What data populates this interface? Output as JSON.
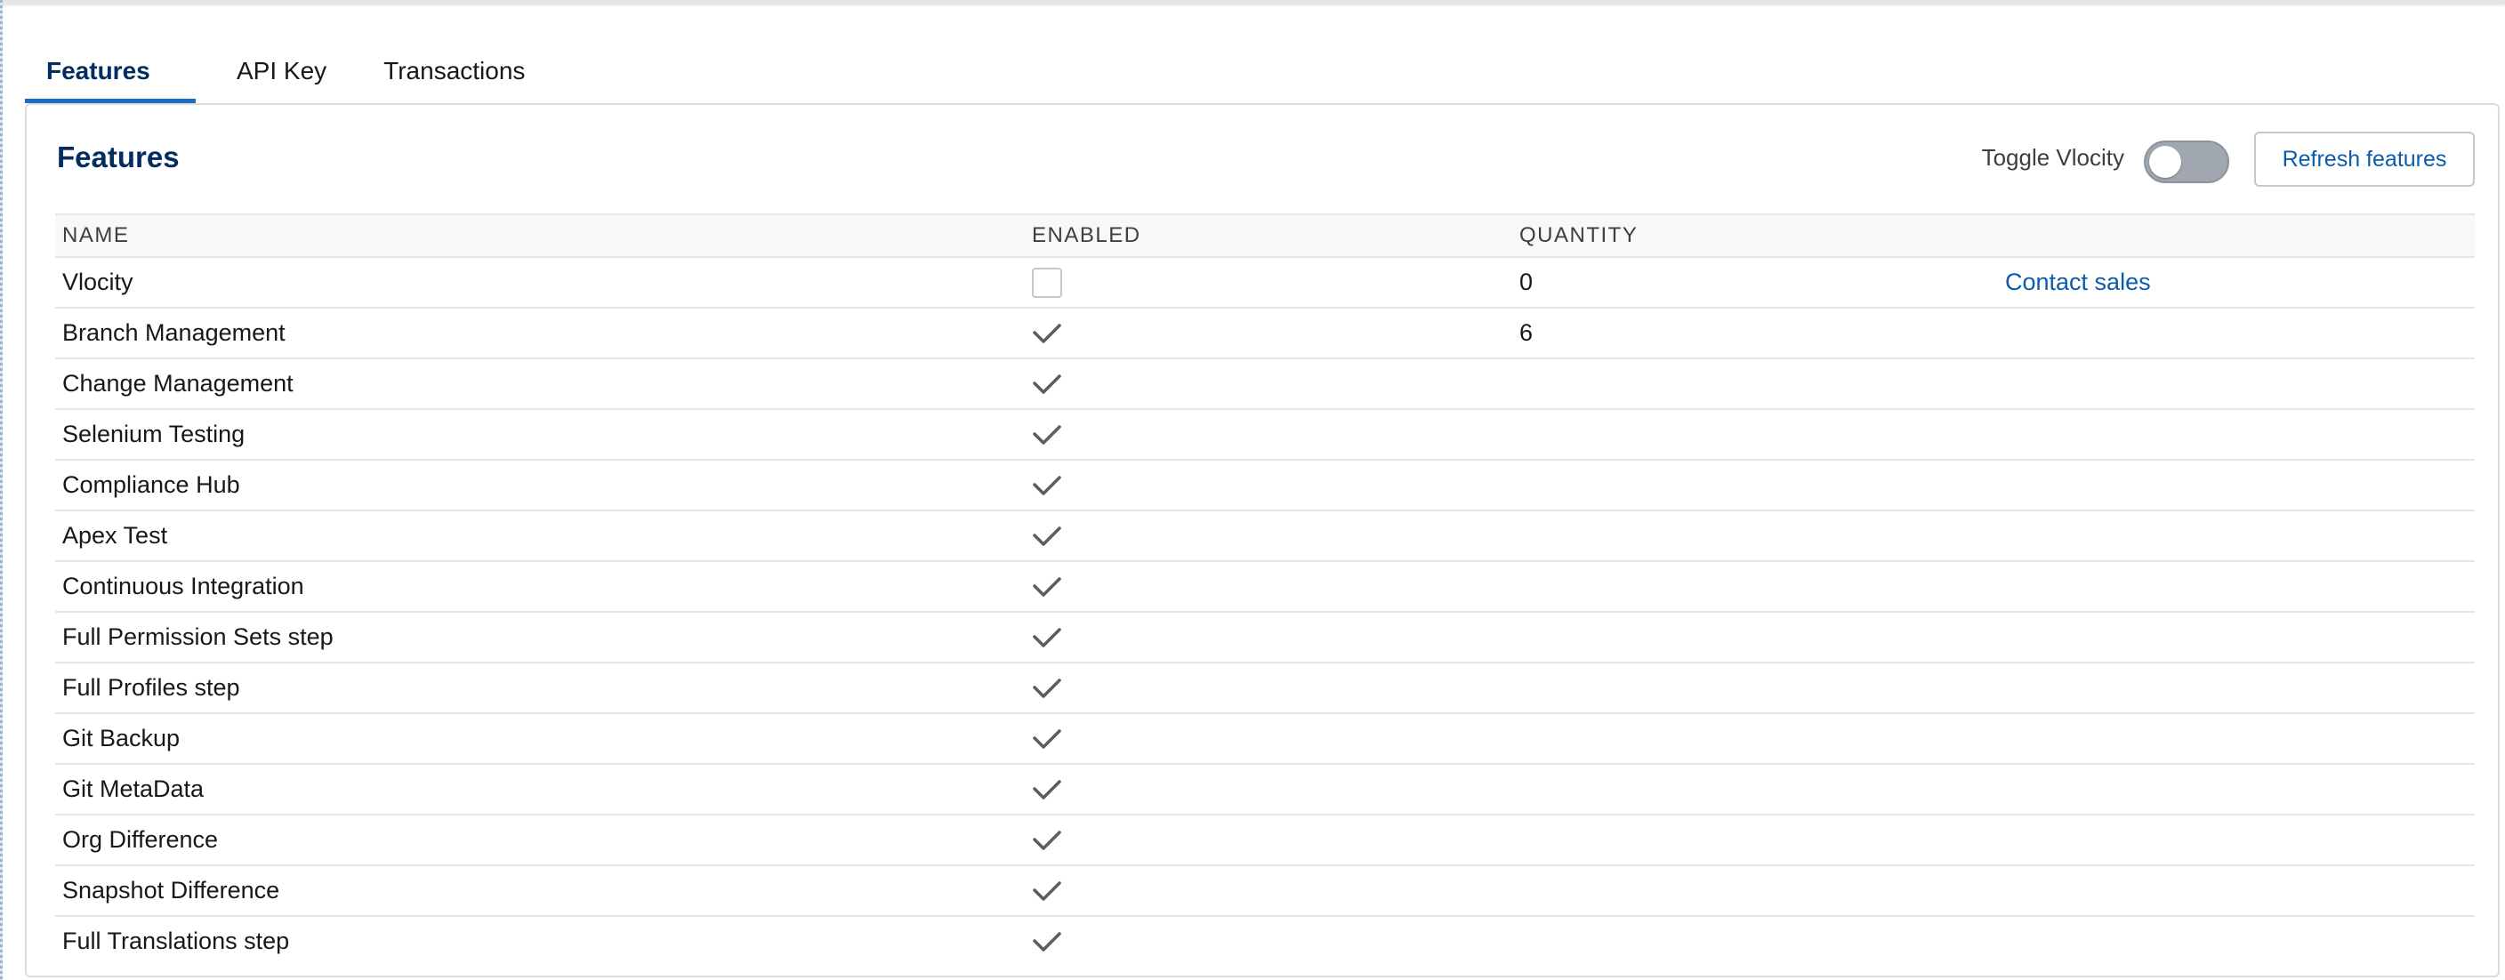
{
  "tabs": [
    {
      "label": "Features",
      "active": true
    },
    {
      "label": "API Key",
      "active": false
    },
    {
      "label": "Transactions",
      "active": false
    }
  ],
  "card": {
    "title": "Features",
    "toggle_label": "Toggle Vlocity",
    "toggle_state": "off",
    "refresh_label": "Refresh features"
  },
  "table": {
    "headers": {
      "name": "NAME",
      "enabled": "ENABLED",
      "quantity": "QUANTITY",
      "action": ""
    },
    "rows": [
      {
        "name": "Vlocity",
        "enabled": false,
        "quantity": "0",
        "action": "Contact sales"
      },
      {
        "name": "Branch Management",
        "enabled": true,
        "quantity": "6",
        "action": ""
      },
      {
        "name": "Change Management",
        "enabled": true,
        "quantity": "",
        "action": ""
      },
      {
        "name": "Selenium Testing",
        "enabled": true,
        "quantity": "",
        "action": ""
      },
      {
        "name": "Compliance Hub",
        "enabled": true,
        "quantity": "",
        "action": ""
      },
      {
        "name": "Apex Test",
        "enabled": true,
        "quantity": "",
        "action": ""
      },
      {
        "name": "Continuous Integration",
        "enabled": true,
        "quantity": "",
        "action": ""
      },
      {
        "name": "Full Permission Sets step",
        "enabled": true,
        "quantity": "",
        "action": ""
      },
      {
        "name": "Full Profiles step",
        "enabled": true,
        "quantity": "",
        "action": ""
      },
      {
        "name": "Git Backup",
        "enabled": true,
        "quantity": "",
        "action": ""
      },
      {
        "name": "Git MetaData",
        "enabled": true,
        "quantity": "",
        "action": ""
      },
      {
        "name": "Org Difference",
        "enabled": true,
        "quantity": "",
        "action": ""
      },
      {
        "name": "Snapshot Difference",
        "enabled": true,
        "quantity": "",
        "action": ""
      },
      {
        "name": "Full Translations step",
        "enabled": true,
        "quantity": "",
        "action": ""
      }
    ]
  },
  "colors": {
    "accent": "#1b6ec2",
    "title": "#032d60",
    "link": "#0b5cab",
    "toggle_off": "#a0a7b0"
  },
  "icons": {
    "enabled": "checkmark-icon",
    "disabled": "empty-checkbox"
  }
}
